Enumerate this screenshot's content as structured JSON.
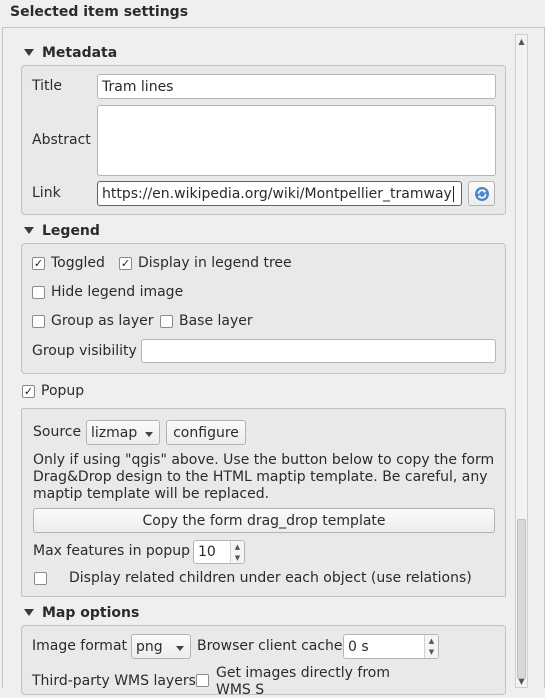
{
  "panel": {
    "title": "Selected item settings"
  },
  "metadata": {
    "header": "Metadata",
    "title_label": "Title",
    "title_value": "Tram lines",
    "abstract_label": "Abstract",
    "abstract_value": "",
    "link_label": "Link",
    "link_value": "https://en.wikipedia.org/wiki/Montpellier_tramway"
  },
  "legend": {
    "header": "Legend",
    "toggled_label": "Toggled",
    "toggled_checked": true,
    "display_tree_label": "Display in legend tree",
    "display_tree_checked": true,
    "hide_image_label": "Hide legend image",
    "hide_image_checked": false,
    "group_as_layer_label": "Group as layer",
    "group_as_layer_checked": false,
    "base_layer_label": "Base layer",
    "base_layer_checked": false,
    "group_visibility_label": "Group visibility",
    "group_visibility_value": ""
  },
  "popup": {
    "checkbox_label": "Popup",
    "checked": true,
    "source_label": "Source",
    "source_value": "lizmap",
    "configure_label": "configure",
    "note_line1": "Only if using \"qgis\" above. Use the button below to copy the form",
    "note_line2": "Drag&Drop design to the HTML maptip template. Be careful, any",
    "note_line3": "maptip template will be replaced.",
    "copy_button_label": "Copy the form drag_drop template",
    "max_features_label": "Max features in popup",
    "max_features_value": "10",
    "related_children_label": "Display related children under each object (use relations)",
    "related_children_checked": false
  },
  "map_options": {
    "header": "Map options",
    "image_format_label": "Image format",
    "image_format_value": "png",
    "browser_cache_label": "Browser client cache",
    "browser_cache_value": "0 s",
    "third_party_label": "Third-party WMS layers",
    "direct_images_label_line1": "Get images directly from",
    "direct_images_label_line2": "WMS S",
    "direct_images_checked": false
  }
}
